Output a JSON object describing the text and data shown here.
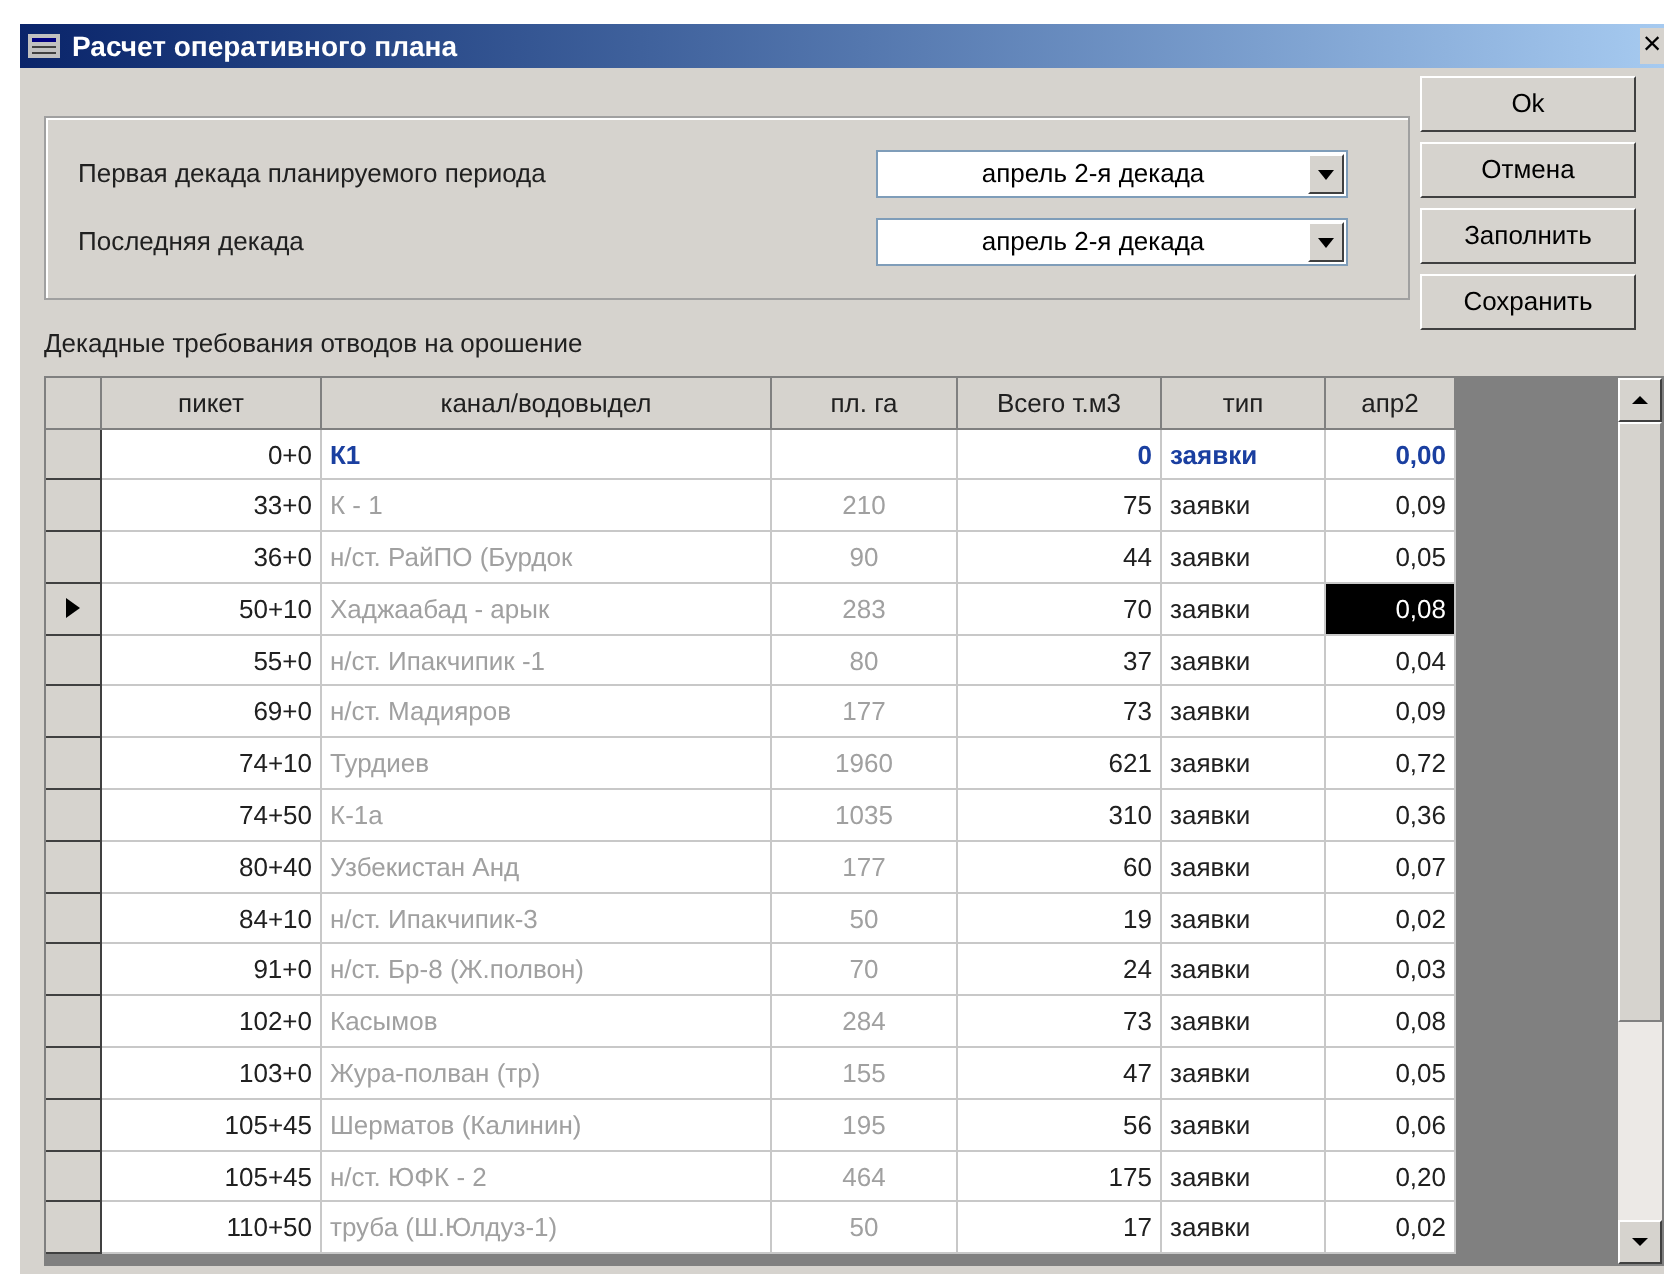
{
  "window": {
    "title": "Расчет оперативного плана",
    "close": "×"
  },
  "period": {
    "first_label": "Первая декада планируемого периода",
    "first_value": "апрель 2-я декада",
    "last_label": "Последняя декада",
    "last_value": "апрель 2-я декада"
  },
  "buttons": [
    "Ok",
    "Отмена",
    "Заполнить",
    "Сохранить"
  ],
  "table_caption": "Декадные требования отводов на орошение",
  "table": {
    "columns": [
      "пикет",
      "канал/водовыдел",
      "пл. га",
      "Всего т.м3",
      "тип",
      "апр2"
    ],
    "rows": [
      {
        "kind": "total",
        "selected": false,
        "cells": [
          "0+0",
          "К1",
          "",
          "0",
          "заявки",
          "0,00"
        ]
      },
      {
        "kind": "item",
        "selected": false,
        "cells": [
          "33+0",
          "К - 1",
          "210",
          "75",
          "заявки",
          "0,09"
        ]
      },
      {
        "kind": "item",
        "selected": false,
        "cells": [
          "36+0",
          "н/ст. РайПО (Бурдок",
          "90",
          "44",
          "заявки",
          "0,05"
        ]
      },
      {
        "kind": "item",
        "selected": true,
        "cells": [
          "50+10",
          "Хаджаабад - арык",
          "283",
          "70",
          "заявки",
          "0,08"
        ]
      },
      {
        "kind": "item",
        "selected": false,
        "cells": [
          "55+0",
          "н/ст. Ипакчипик -1",
          "80",
          "37",
          "заявки",
          "0,04"
        ]
      },
      {
        "kind": "item",
        "selected": false,
        "cells": [
          "69+0",
          "н/ст. Мадияров",
          "177",
          "73",
          "заявки",
          "0,09"
        ]
      },
      {
        "kind": "item",
        "selected": false,
        "cells": [
          "74+10",
          "Турдиев",
          "1960",
          "621",
          "заявки",
          "0,72"
        ]
      },
      {
        "kind": "item",
        "selected": false,
        "cells": [
          "74+50",
          "К-1а",
          "1035",
          "310",
          "заявки",
          "0,36"
        ]
      },
      {
        "kind": "item",
        "selected": false,
        "cells": [
          "80+40",
          "Узбекистан Анд",
          "177",
          "60",
          "заявки",
          "0,07"
        ]
      },
      {
        "kind": "item",
        "selected": false,
        "cells": [
          "84+10",
          "н/ст. Ипакчипик-3",
          "50",
          "19",
          "заявки",
          "0,02"
        ]
      },
      {
        "kind": "item",
        "selected": false,
        "cells": [
          "91+0",
          "н/ст. Бр-8 (Ж.полвон)",
          "70",
          "24",
          "заявки",
          "0,03"
        ]
      },
      {
        "kind": "item",
        "selected": false,
        "cells": [
          "102+0",
          "Касымов",
          "284",
          "73",
          "заявки",
          "0,08"
        ]
      },
      {
        "kind": "item",
        "selected": false,
        "cells": [
          "103+0",
          "Жура-полван (тр)",
          "155",
          "47",
          "заявки",
          "0,05"
        ]
      },
      {
        "kind": "item",
        "selected": false,
        "cells": [
          "105+45",
          "Шерматов (Калинин)",
          "195",
          "56",
          "заявки",
          "0,06"
        ]
      },
      {
        "kind": "item",
        "selected": false,
        "cells": [
          "105+45",
          "н/ст. ЮФК - 2",
          "464",
          "175",
          "заявки",
          "0,20"
        ]
      },
      {
        "kind": "item",
        "selected": false,
        "cells": [
          "110+50",
          "труба (Ш.Юлдуз-1)",
          "50",
          "17",
          "заявки",
          "0,02"
        ]
      }
    ]
  }
}
